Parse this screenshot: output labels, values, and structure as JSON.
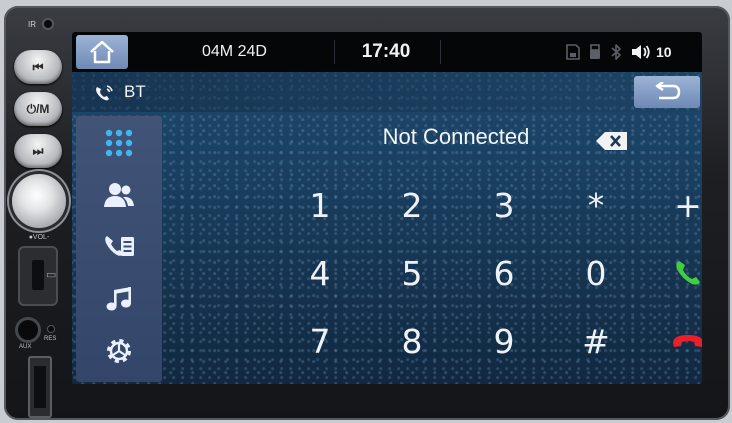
{
  "head_unit": {
    "ir_label": "IR",
    "buttons": [
      {
        "name": "prev-track-button",
        "label": "⏮"
      },
      {
        "name": "power-mode-button",
        "label": "⏻/M"
      },
      {
        "name": "next-track-button",
        "label": "⏭"
      }
    ],
    "vol_label": "●VOL-",
    "aux_label": "AUX",
    "res_label": "RES"
  },
  "status_bar": {
    "date": "04M 24D",
    "time": "17:40",
    "volume": "10",
    "icons": [
      "sd-card-icon",
      "usb-icon",
      "bluetooth-icon",
      "speaker-icon"
    ]
  },
  "bt_bar": {
    "label": "BT"
  },
  "sidebar": {
    "items": [
      {
        "name": "sidebar-item-dialpad",
        "icon": "dialpad-icon",
        "active": true
      },
      {
        "name": "sidebar-item-contacts",
        "icon": "contacts-icon"
      },
      {
        "name": "sidebar-item-call-log",
        "icon": "call-log-icon"
      },
      {
        "name": "sidebar-item-music",
        "icon": "music-icon"
      },
      {
        "name": "sidebar-item-settings",
        "icon": "settings-icon"
      }
    ]
  },
  "dialer": {
    "status": "Not Connected",
    "keys": [
      [
        "1",
        "2",
        "3",
        "*",
        "+"
      ],
      [
        "4",
        "5",
        "6",
        "0",
        "call"
      ],
      [
        "7",
        "8",
        "9",
        "#",
        "hangup"
      ]
    ]
  },
  "colors": {
    "accent_button": "#7f99c4",
    "call_green": "#3fcf3f",
    "hangup_red": "#e8202a",
    "sidebar_icon": "#eaf0ff"
  }
}
